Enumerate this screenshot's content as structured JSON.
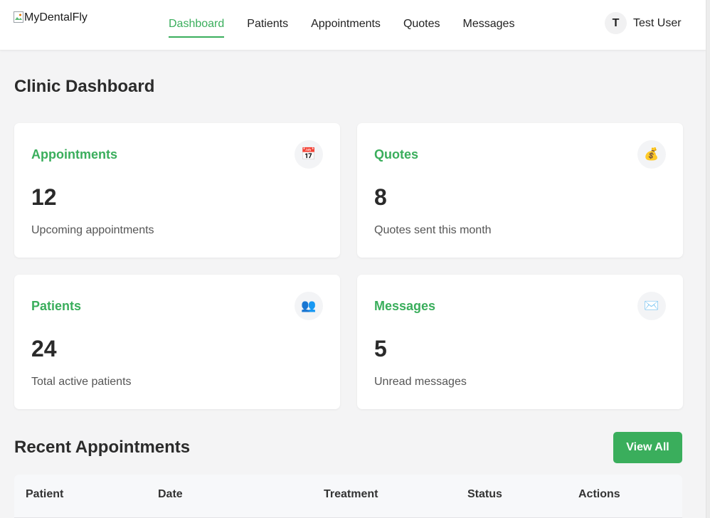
{
  "header": {
    "logo_alt": "MyDentalFly",
    "nav": [
      {
        "label": "Dashboard",
        "active": true
      },
      {
        "label": "Patients",
        "active": false
      },
      {
        "label": "Appointments",
        "active": false
      },
      {
        "label": "Quotes",
        "active": false
      },
      {
        "label": "Messages",
        "active": false
      }
    ],
    "user": {
      "initial": "T",
      "name": "Test User"
    }
  },
  "page": {
    "title": "Clinic Dashboard"
  },
  "cards": [
    {
      "title": "Appointments",
      "icon": "calendar-icon",
      "glyph": "📅",
      "value": "12",
      "desc": "Upcoming appointments"
    },
    {
      "title": "Quotes",
      "icon": "money-bag-icon",
      "glyph": "💰",
      "value": "8",
      "desc": "Quotes sent this month"
    },
    {
      "title": "Patients",
      "icon": "users-icon",
      "glyph": "👥",
      "value": "24",
      "desc": "Total active patients"
    },
    {
      "title": "Messages",
      "icon": "envelope-icon",
      "glyph": "✉️",
      "value": "5",
      "desc": "Unread messages"
    }
  ],
  "recent": {
    "title": "Recent Appointments",
    "view_all_label": "View All",
    "columns": [
      "Patient",
      "Date",
      "Treatment",
      "Status",
      "Actions"
    ]
  },
  "colors": {
    "accent": "#3aae5c",
    "background": "#f4f4f5",
    "card": "#ffffff"
  }
}
